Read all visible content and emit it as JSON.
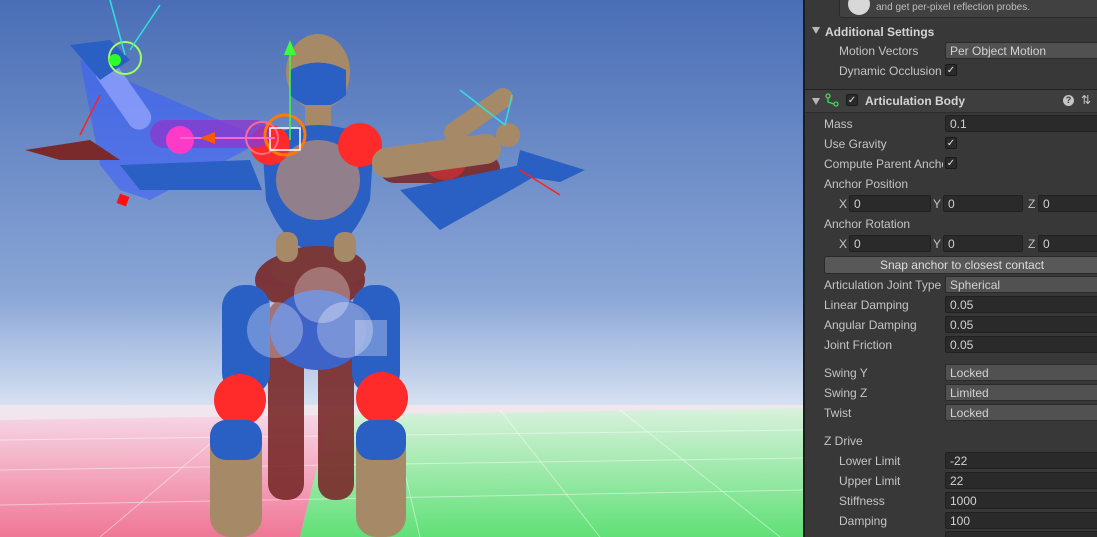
{
  "info_box": {
    "text": "and get per-pixel reflection probes."
  },
  "additional_settings": {
    "title": "Additional Settings",
    "motion_vectors_label": "Motion Vectors",
    "motion_vectors_value": "Per Object Motion",
    "dynamic_occlusion_label": "Dynamic Occlusion",
    "dynamic_occlusion_checked": true
  },
  "articulation_body": {
    "title": "Articulation Body",
    "enabled": true,
    "mass_label": "Mass",
    "mass_value": "0.1",
    "use_gravity_label": "Use Gravity",
    "use_gravity_checked": true,
    "compute_parent_anchor_label": "Compute Parent Anchor",
    "compute_parent_anchor_checked": true,
    "anchor_position_label": "Anchor Position",
    "anchor_position": {
      "x_label": "X",
      "x": "0",
      "y_label": "Y",
      "y": "0",
      "z_label": "Z",
      "z": "0"
    },
    "anchor_rotation_label": "Anchor Rotation",
    "anchor_rotation": {
      "x_label": "X",
      "x": "0",
      "y_label": "Y",
      "y": "0",
      "z_label": "Z",
      "z": "0"
    },
    "snap_button_label": "Snap anchor to closest contact",
    "joint_type_label": "Articulation Joint Type",
    "joint_type_value": "Spherical",
    "linear_damping_label": "Linear Damping",
    "linear_damping_value": "0.05",
    "angular_damping_label": "Angular Damping",
    "angular_damping_value": "0.05",
    "joint_friction_label": "Joint Friction",
    "joint_friction_value": "0.05",
    "swing_y_label": "Swing Y",
    "swing_y_value": "Locked",
    "swing_z_label": "Swing Z",
    "swing_z_value": "Limited",
    "twist_label": "Twist",
    "twist_value": "Locked",
    "z_drive_label": "Z Drive",
    "lower_limit_label": "Lower Limit",
    "lower_limit_value": "-22",
    "upper_limit_label": "Upper Limit",
    "upper_limit_value": "22",
    "stiffness_label": "Stiffness",
    "stiffness_value": "1000",
    "damping_label": "Damping",
    "damping_value": "100"
  },
  "colors": {
    "sky_top": "#4d72b8",
    "sky_bottom": "#c9d6ee",
    "body_blue": "#2a5fc4",
    "body_tan": "#a68a68",
    "joint_red": "#ff2a2a",
    "inspector_bg": "#383838"
  },
  "icons": {
    "help": "help-icon",
    "settings": "preset-settings-icon",
    "component": "articulation-body-icon",
    "info": "info-icon"
  }
}
